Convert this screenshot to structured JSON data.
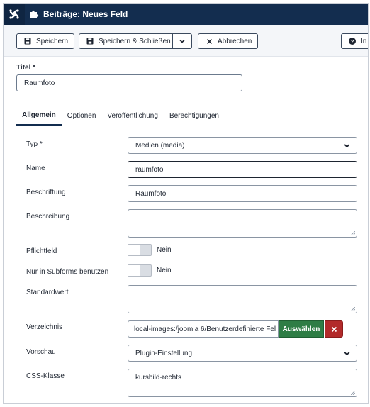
{
  "header": {
    "title": "Beiträge: Neues Feld"
  },
  "toolbar": {
    "save_label": "Speichern",
    "save_close_label": "Speichern & Schließen",
    "cancel_label": "Abbrechen",
    "help_label": "In"
  },
  "title_field": {
    "label": "Titel *",
    "value": "Raumfoto"
  },
  "tabs": [
    {
      "label": "Allgemein",
      "active": true
    },
    {
      "label": "Optionen",
      "active": false
    },
    {
      "label": "Veröffentlichung",
      "active": false
    },
    {
      "label": "Berechtigungen",
      "active": false
    }
  ],
  "form": {
    "typ": {
      "label": "Typ *",
      "value": "Medien (media)"
    },
    "name": {
      "label": "Name",
      "value": "raumfoto"
    },
    "beschriftung": {
      "label": "Beschriftung",
      "value": "Raumfoto"
    },
    "beschreibung": {
      "label": "Beschreibung",
      "value": ""
    },
    "pflichtfeld": {
      "label": "Pflichtfeld",
      "value": "Nein"
    },
    "subforms": {
      "label": "Nur in Subforms benutzen",
      "value": "Nein"
    },
    "standardwert": {
      "label": "Standardwert",
      "value": ""
    },
    "verzeichnis": {
      "label": "Verzeichnis",
      "value": "local-images:/joomla 6/Benutzerdefinierte Fel",
      "select_label": "Auswählen"
    },
    "vorschau": {
      "label": "Vorschau",
      "value": "Plugin-Einstellung"
    },
    "css_klasse": {
      "label": "CSS-Klasse",
      "value": "kursbild-rechts"
    }
  },
  "colors": {
    "header_bg": "#132d4f",
    "select_button": "#2e7d45",
    "clear_button": "#b22a2a"
  }
}
